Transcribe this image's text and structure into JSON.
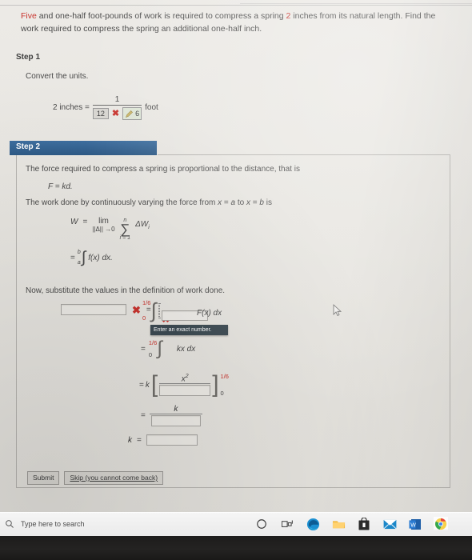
{
  "problem": {
    "lead": "Five",
    "text_after_lead": " and one-half foot-pounds of work is required to compress a spring ",
    "quantity": "2",
    "text_after_quantity": " inches from its natural length. Find the work required to compress the spring an additional one-half inch."
  },
  "step1": {
    "title": "Step 1",
    "instruction": "Convert the units.",
    "lhs": "2 inches =",
    "numerator": "1",
    "denominator_value": "12",
    "denominator_mark": "✖",
    "correct_value": "6",
    "unit": "foot"
  },
  "step2": {
    "banner": "Step 2",
    "line1": "The force required to compress a spring is proportional to the distance, that is",
    "formula_f": "F = kd.",
    "line2_a": "The work done by continuously varying the force from ",
    "line2_x1": "x",
    "line2_eq1": " = ",
    "line2_a_var": "a",
    "line2_to": " to ",
    "line2_x2": "x",
    "line2_eq2": " = ",
    "line2_b_var": "b",
    "line2_is": " is",
    "w_label": "W",
    "equals": "=",
    "lim_label": "lim",
    "lim_sub": "||Δ|| →0",
    "sigma_top": "n",
    "sigma_bot": "i = 1",
    "sigma_term": "ΔW",
    "sigma_term_sub": "i",
    "int_upper": "b",
    "int_lower": "a",
    "int_body": "f(x) dx.",
    "substitute": "Now, substitute the values in the definition of work done.",
    "answer1_value": "",
    "answer1_mark": "✖",
    "focus_upper": "1/6",
    "focus_lower": "0",
    "focus_input_value": "",
    "focus_mark": "✖",
    "focus_tail": "F(x) dx",
    "tooltip": "Enter an exact number.",
    "kx_upper": "1/6",
    "kx_lower": "0",
    "kx_body": "kx dx",
    "bracket_k": "k",
    "bracket_open": "[",
    "bracket_close": "]",
    "bracket_num": "x",
    "bracket_num_exp": "2",
    "bracket_den_value": "",
    "bracket_upper": "1/6",
    "bracket_lower": "0",
    "krow_num": "k",
    "krow_den_value": "",
    "kfinal_label": "k",
    "kfinal_value": "",
    "submit_label": "Submit",
    "skip_label": "Skip (you cannot come back)"
  },
  "taskbar": {
    "search_placeholder": "Type here to search",
    "icons": [
      {
        "name": "cortana-icon",
        "label": "Cortana"
      },
      {
        "name": "task-view-icon",
        "label": "Task View"
      },
      {
        "name": "microsoft-edge-icon",
        "label": "Microsoft Edge"
      },
      {
        "name": "file-explorer-icon",
        "label": "File Explorer"
      },
      {
        "name": "microsoft-store-icon",
        "label": "Microsoft Store"
      },
      {
        "name": "mail-icon",
        "label": "Mail"
      },
      {
        "name": "office-word-icon",
        "label": "Word"
      },
      {
        "name": "google-chrome-icon",
        "label": "Google Chrome"
      }
    ]
  },
  "colors": {
    "accent_red": "#c9342e",
    "banner_blue": "#2e5a86",
    "tooltip_bg": "#3c4a52",
    "page_bg": "#eceae6"
  }
}
